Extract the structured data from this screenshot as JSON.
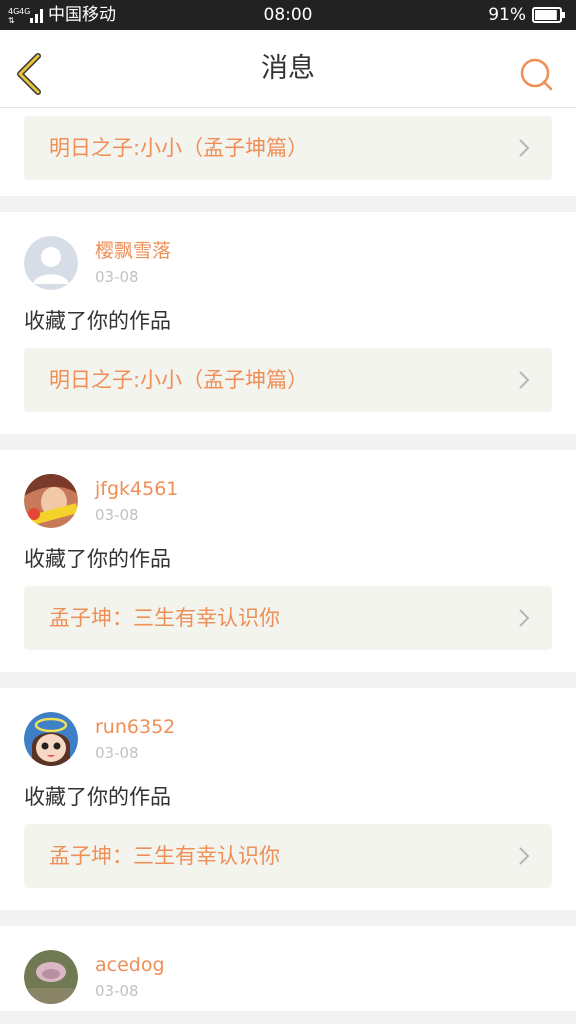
{
  "status_bar": {
    "network": "4G",
    "carrier": "中国移动",
    "time": "08:00",
    "battery": "91%",
    "battery_level": 0.91
  },
  "header": {
    "title": "消息",
    "back_icon": "chevron-left-icon",
    "search_icon": "search-icon"
  },
  "colors": {
    "accent": "#ee8f57",
    "back_icon": "#d4a72c",
    "card_bg": "#f4f4ef",
    "page_bg": "#f2f2f2"
  },
  "feed": {
    "partial": {
      "work_title": "明日之子:小小（孟子坤篇）"
    },
    "items": [
      {
        "username": "樱飘雪落",
        "date": "03-08",
        "action": "收藏了你的作品",
        "work_title": "明日之子:小小（孟子坤篇）",
        "avatar": "default-avatar"
      },
      {
        "username": "jfgk4561",
        "date": "03-08",
        "action": "收藏了你的作品",
        "work_title": "孟子坤：三生有幸认识你",
        "avatar": "photo-avatar"
      },
      {
        "username": "run6352",
        "date": "03-08",
        "action": "收藏了你的作品",
        "work_title": "孟子坤：三生有幸认识你",
        "avatar": "cartoon-avatar"
      },
      {
        "username": "acedog",
        "date": "03-08",
        "avatar": "photo-avatar"
      }
    ]
  }
}
